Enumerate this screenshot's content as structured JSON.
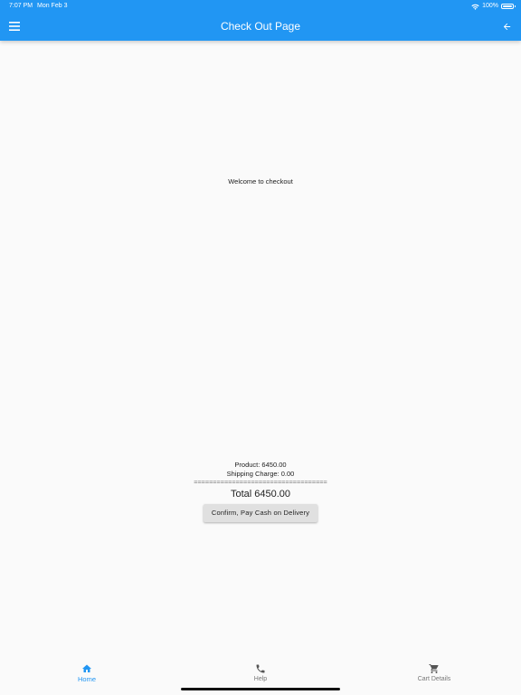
{
  "status_bar": {
    "time": "7:07 PM",
    "date": "Mon Feb 3",
    "battery": "100%"
  },
  "header": {
    "title": "Check Out Page"
  },
  "main": {
    "welcome": "Welcome to checkout"
  },
  "summary": {
    "product": "Product: 6450.00",
    "shipping": "Shipping Charge: 0.00",
    "divider": "===================================",
    "total": "Total 6450.00",
    "confirm_label": "Confirm, Pay Cash on Delivery"
  },
  "bottom_nav": {
    "items": [
      {
        "label": "Home",
        "icon": "home-icon",
        "active": true
      },
      {
        "label": "Help",
        "icon": "phone-icon",
        "active": false
      },
      {
        "label": "Cart Details",
        "icon": "cart-icon",
        "active": false
      }
    ]
  },
  "colors": {
    "app_bar": "#2196f3",
    "active_nav": "#2196f3",
    "inactive_nav": "#777777",
    "background": "#fafafa"
  }
}
